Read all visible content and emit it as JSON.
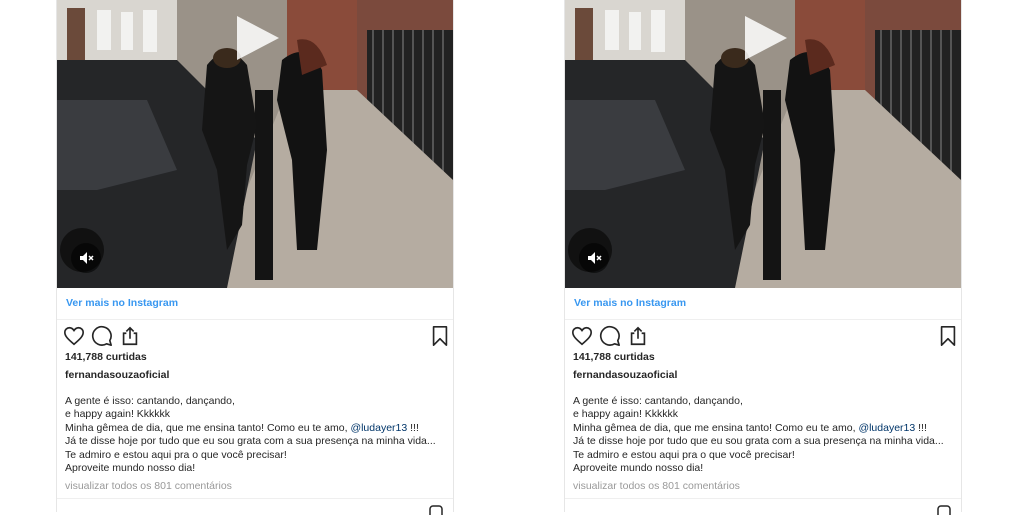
{
  "posts": [
    {
      "more_link": "Ver mais no Instagram",
      "likes": "141,788 curtidas",
      "author": "fernandasouzaoficial",
      "caption_lines": [
        "A gente é isso: cantando, dançando,",
        "e happy again! Kkkkkk",
        "Minha gêmea de dia, que me ensina tanto! Como eu te amo, ",
        "Já te disse hoje por tudo que eu sou grata com a sua presença na minha vida...",
        "Te admiro e estou aqui pra o que você precisar!",
        "Aproveite mundo nosso dia!"
      ],
      "mention": "@ludayer13",
      "mention_suffix": " !!!",
      "comments": "visualizar todos os 801 comentários"
    },
    {
      "more_link": "Ver mais no Instagram",
      "likes": "141,788 curtidas",
      "author": "fernandasouzaoficial",
      "caption_lines": [
        "A gente é isso: cantando, dançando,",
        "e happy again! Kkkkkk",
        "Minha gêmea de dia, que me ensina tanto! Como eu te amo, ",
        "Já te disse hoje por tudo que eu sou grata com a sua presença na minha vida...",
        "Te admiro e estou aqui pra o que você precisar!",
        "Aproveite mundo nosso dia!"
      ],
      "mention": "@ludayer13",
      "mention_suffix": " !!!",
      "comments": "visualizar todos os 801 comentários"
    }
  ],
  "icons": {
    "play": "play-icon",
    "mute": "volume-muted-icon",
    "like": "heart-icon",
    "comment": "comment-icon",
    "share": "share-icon",
    "save": "bookmark-icon"
  },
  "colors": {
    "link": "#3897f0",
    "mention": "#003569",
    "muted_text": "#999999",
    "text": "#262626"
  }
}
